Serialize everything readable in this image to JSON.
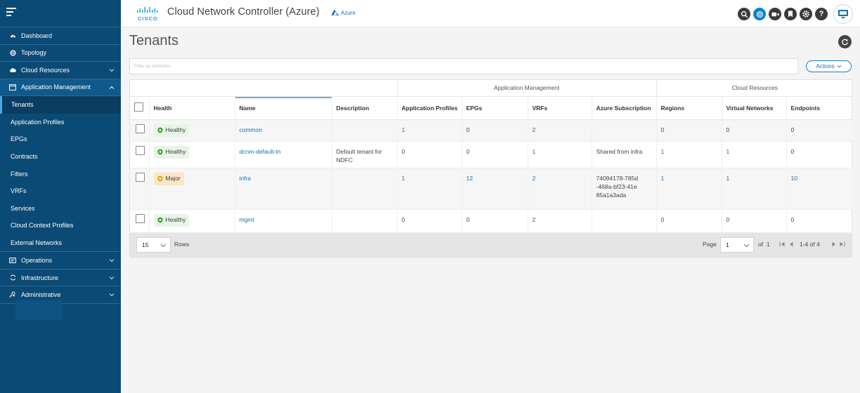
{
  "header": {
    "logo_text": "CISCO",
    "app_title": "Cloud Network Controller (Azure)",
    "azure_tag": "Azure",
    "icons": [
      "search-icon",
      "target-icon",
      "video-icon",
      "bookmark-icon",
      "gear-icon",
      "help-icon",
      "screen-icon"
    ],
    "accent_color": "#0d84c9"
  },
  "sidebar": {
    "bg_color": "#0b4a74",
    "items": [
      {
        "label": "Dashboard",
        "icon": "dashboard-icon"
      },
      {
        "label": "Topology",
        "icon": "globe-icon"
      },
      {
        "label": "Cloud Resources",
        "icon": "cloud-icon"
      },
      {
        "label": "Application Management",
        "icon": "app-window-icon"
      }
    ],
    "sub_items": [
      "Tenants",
      "Application Profiles",
      "EPGs",
      "Contracts",
      "Filters",
      "VRFs",
      "Services",
      "Cloud Context Profiles",
      "External Networks"
    ],
    "bottom_items": [
      {
        "label": "Operations",
        "icon": "operations-icon"
      },
      {
        "label": "Infrastructure",
        "icon": "sync-icon"
      },
      {
        "label": "Administrative",
        "icon": "admin-icon"
      }
    ]
  },
  "main": {
    "title": "Tenants",
    "filter_placeholder": "Filter by attributes",
    "actions_label": "Actions",
    "table": {
      "group_headers": {
        "app_mgmt": "Application Management",
        "cloud_res": "Cloud Resources"
      },
      "columns": [
        "Health",
        "Name",
        "Description",
        "Application Profiles",
        "EPGs",
        "VRFs",
        "Azure Subscription",
        "Regions",
        "Virtual Networks",
        "Endpoints"
      ],
      "rows": [
        {
          "health": "Healthy",
          "name": "common",
          "description": "",
          "app_profiles": "1",
          "epgs": "0",
          "vrfs": "2",
          "subscription": "",
          "regions": "0",
          "vnets": "0",
          "endpoints": "0"
        },
        {
          "health": "Healthy",
          "name": "dcnm-default-tn",
          "description": "Default tenant for NDFC",
          "app_profiles": "0",
          "epgs": "0",
          "vrfs": "1",
          "subscription": "Shared from infra",
          "regions": "1",
          "vnets": "1",
          "endpoints": "0"
        },
        {
          "health": "Major",
          "name": "infra",
          "description": "",
          "app_profiles": "1",
          "epgs": "12",
          "vrfs": "2",
          "subscription": "74094178-785d-468a-bf23-41e85a1a3ada",
          "regions": "1",
          "vnets": "1",
          "endpoints": "10"
        },
        {
          "health": "Healthy",
          "name": "mgmt",
          "description": "",
          "app_profiles": "0",
          "epgs": "0",
          "vrfs": "2",
          "subscription": "",
          "regions": "0",
          "vnets": "0",
          "endpoints": "0"
        }
      ]
    },
    "pagination": {
      "rows_value": "15",
      "rows_label": "Rows",
      "page_label": "Page",
      "page_value": "1",
      "of_label": "of",
      "total_pages": "1",
      "range": "1-4 of 4"
    },
    "status_colors": {
      "healthy": "#3c9f3c",
      "major": "#e4a11b"
    }
  }
}
